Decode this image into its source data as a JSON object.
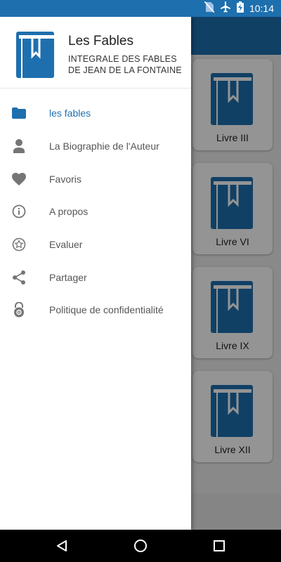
{
  "status_bar": {
    "time": "10:14",
    "icons": [
      "no-sim-icon",
      "airplane-mode-icon",
      "battery-charging-icon"
    ]
  },
  "drawer": {
    "title": "Les Fables",
    "subtitle": "INTEGRALE DES FABLES DE JEAN DE LA FONTAINE",
    "items": [
      {
        "label": "les fables",
        "icon": "folder-icon",
        "active": true
      },
      {
        "label": "La Biographie de l'Auteur",
        "icon": "person-icon",
        "active": false
      },
      {
        "label": "Favoris",
        "icon": "heart-icon",
        "active": false
      },
      {
        "label": "A propos",
        "icon": "info-icon",
        "active": false
      },
      {
        "label": "Evaluer",
        "icon": "star-rate-icon",
        "active": false
      },
      {
        "label": "Partager",
        "icon": "share-icon",
        "active": false
      },
      {
        "label": "Politique de confidentialité",
        "icon": "privacy-lock-icon",
        "active": false
      }
    ]
  },
  "background_grid": {
    "cards": [
      {
        "label": "Livre III"
      },
      {
        "label": "Livre VI"
      },
      {
        "label": "Livre IX"
      },
      {
        "label": "Livre XII"
      }
    ]
  },
  "colors": {
    "primary": "#1e6fae",
    "active_text": "#1e6fae",
    "icon_gray": "#757575"
  }
}
